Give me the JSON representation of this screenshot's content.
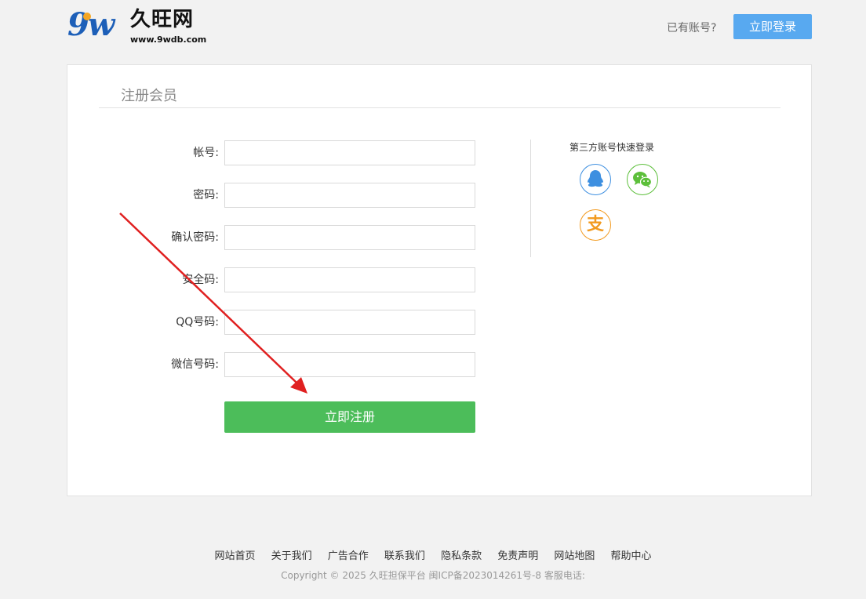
{
  "header": {
    "logo_mark": "9w",
    "logo_name": "久旺网",
    "logo_url": "www.9wdb.com",
    "has_account": "已有账号?",
    "login_button": "立即登录"
  },
  "form": {
    "title": "注册会员",
    "fields": [
      {
        "label": "帐号:",
        "value": "",
        "placeholder": ""
      },
      {
        "label": "密码:",
        "value": "",
        "placeholder": ""
      },
      {
        "label": "确认密码:",
        "value": "",
        "placeholder": ""
      },
      {
        "label": "安全码:",
        "value": "",
        "placeholder": ""
      },
      {
        "label": "QQ号码:",
        "value": "",
        "placeholder": ""
      },
      {
        "label": "微信号码:",
        "value": "",
        "placeholder": ""
      }
    ],
    "submit_label": "立即注册"
  },
  "third_party": {
    "title": "第三方账号快速登录",
    "providers": [
      {
        "name": "qq-icon",
        "color": "#3d8fe0"
      },
      {
        "name": "wechat-icon",
        "color": "#5cbf3a"
      },
      {
        "name": "alipay-icon",
        "color": "#f29a1f",
        "glyph": "支"
      }
    ]
  },
  "footer": {
    "links": [
      "网站首页",
      "关于我们",
      "广告合作",
      "联系我们",
      "隐私条款",
      "免责声明",
      "网站地图",
      "帮助中心"
    ],
    "copyright": "Copyright © 2025 久旺担保平台 闽ICP备2023014261号-8 客服电话:"
  },
  "colors": {
    "accent_blue": "#58a9f0",
    "submit_green": "#4cbd5a",
    "annotation_arrow": "#e02020"
  }
}
